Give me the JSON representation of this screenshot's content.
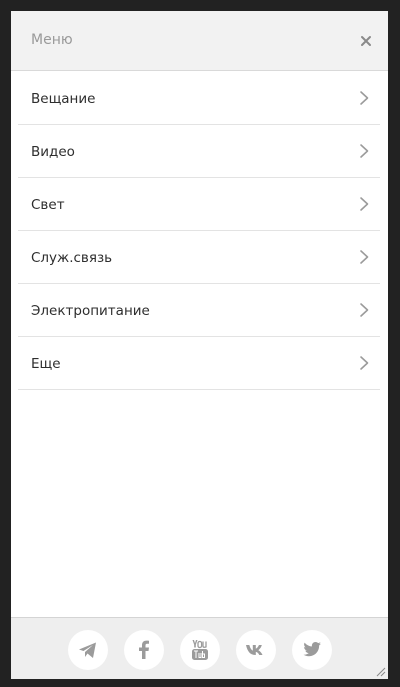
{
  "header": {
    "title": "Меню",
    "close_icon": "close-icon"
  },
  "menu": {
    "items": [
      {
        "label": "Вещание",
        "icon": "chevron-right-icon"
      },
      {
        "label": "Видео",
        "icon": "chevron-right-icon"
      },
      {
        "label": "Свет",
        "icon": "chevron-right-icon"
      },
      {
        "label": "Служ.связь",
        "icon": "chevron-right-icon"
      },
      {
        "label": "Электропитание",
        "icon": "chevron-right-icon"
      },
      {
        "label": "Еще",
        "icon": "chevron-right-icon"
      }
    ]
  },
  "footer": {
    "social": [
      {
        "icon": "telegram-icon",
        "text": ""
      },
      {
        "icon": "facebook-icon",
        "text": ""
      },
      {
        "icon": "youtube-icon",
        "text": ""
      },
      {
        "icon": "vk-icon",
        "text": ""
      },
      {
        "icon": "twitter-icon",
        "text": ""
      }
    ]
  },
  "colors": {
    "frame": "#222222",
    "header_bg": "#f2f2f2",
    "footer_bg": "#eeeeee",
    "icon_gray": "#9b9b9b",
    "text": "#2e2e2e"
  }
}
